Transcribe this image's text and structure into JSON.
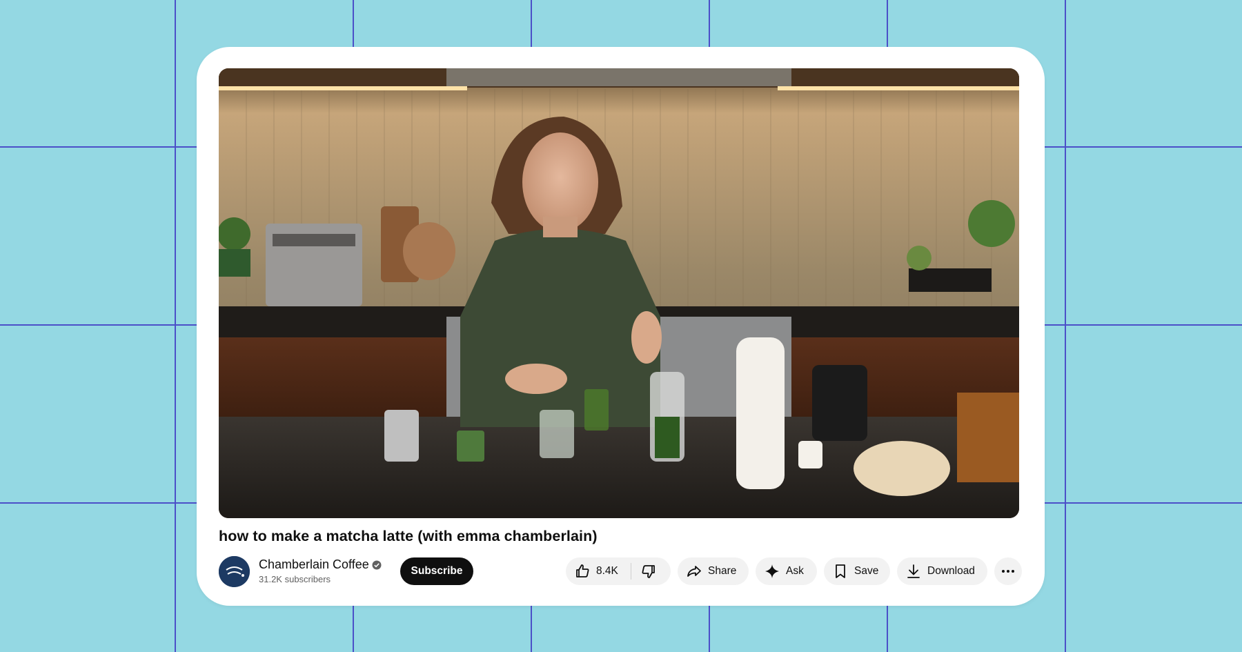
{
  "video": {
    "title": "how to make a matcha latte (with emma chamberlain)"
  },
  "channel": {
    "name": "Chamberlain Coffee",
    "subscribers": "31.2K subscribers",
    "verified_icon": "verified-check-icon",
    "avatar_text": "Chamberlain Coffee"
  },
  "actions": {
    "subscribe_label": "Subscribe",
    "like_count": "8.4K",
    "share_label": "Share",
    "ask_label": "Ask",
    "save_label": "Save",
    "download_label": "Download"
  },
  "colors": {
    "background": "#94d8e3",
    "grid_line": "#4b4fc8",
    "card": "#ffffff",
    "subscribe_bg": "#0f0f0f",
    "pill_bg": "#f2f2f2",
    "avatar_bg": "#1d3a63"
  }
}
